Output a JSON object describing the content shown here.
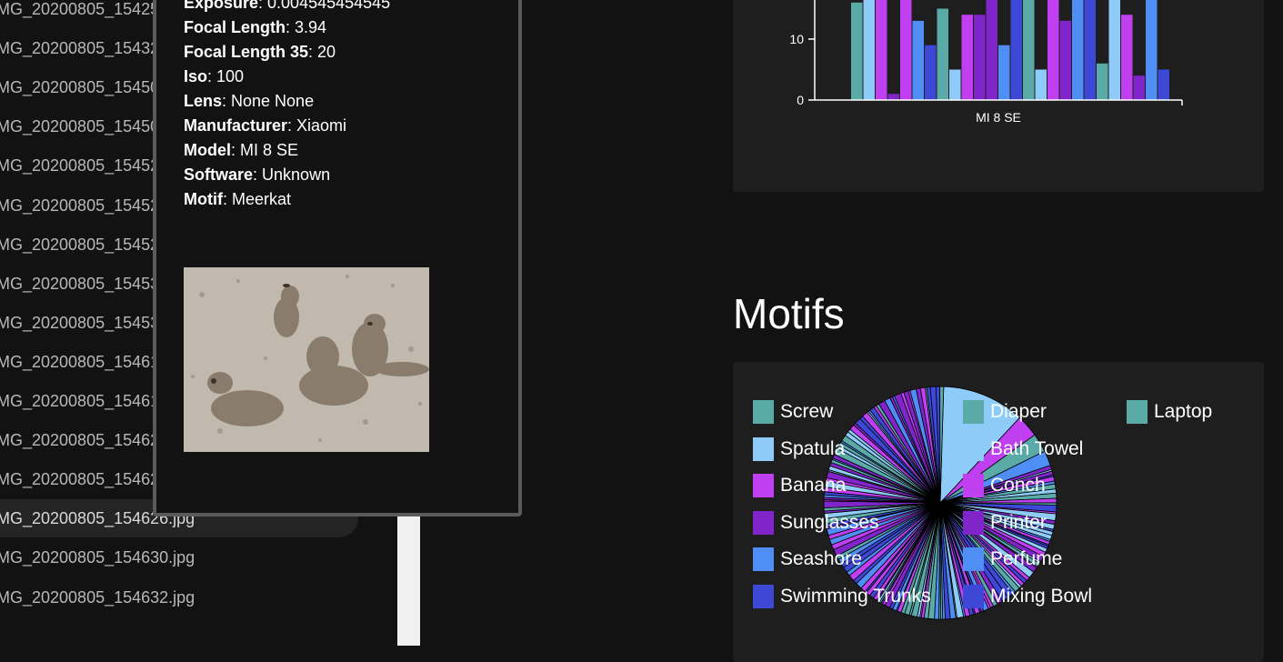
{
  "files": [
    "MG_20200805_15425",
    "MG_20200805_15432",
    "MG_20200805_15450",
    "MG_20200805_15450",
    "MG_20200805_15452",
    "MG_20200805_15452",
    "MG_20200805_15452",
    "MG_20200805_15453",
    "MG_20200805_15453",
    "MG_20200805_15461",
    "MG_20200805_15461",
    "MG_20200805_15462",
    "MG_20200805_15462",
    "MG_20200805_154626.jpg",
    "MG_20200805_154630.jpg",
    "MG_20200805_154632.jpg"
  ],
  "selected_file": "MG_20200805_154626.jpg",
  "popup": {
    "metadata": [
      {
        "key": "Exposure",
        "value": ": 0.004545454545"
      },
      {
        "key": "Focal Length",
        "value": ": 3.94"
      },
      {
        "key": "Focal Length 35",
        "value": ": 20"
      },
      {
        "key": "Iso",
        "value": ": 100"
      },
      {
        "key": "Lens",
        "value": ": None None"
      },
      {
        "key": "Manufacturer",
        "value": ": Xiaomi"
      },
      {
        "key": "Model",
        "value": ": MI 8 SE"
      },
      {
        "key": "Software",
        "value": ": Unknown"
      },
      {
        "key": "Motif",
        "value": ": Meerkat"
      }
    ]
  },
  "motifs_title": "Motifs",
  "colors": {
    "teal": "#5aaaa8",
    "lightblue": "#8ecbf8",
    "magenta": "#c03ff0",
    "purple": "#8025c9",
    "blue": "#4f8ef5",
    "indigo": "#3e48d6"
  },
  "chart_data": [
    {
      "type": "bar",
      "categories": [
        "MI 8 SE"
      ],
      "ylim": [
        0,
        20
      ],
      "yticks": [
        0,
        10
      ],
      "xlabel": "MI 8 SE",
      "values": [
        16,
        20,
        20,
        1,
        20,
        13,
        9,
        15,
        5,
        14,
        14,
        20,
        9,
        20,
        20,
        5,
        20,
        13,
        20,
        20,
        6,
        20,
        14,
        4,
        20,
        5
      ],
      "bar_colors": [
        "teal",
        "lightblue",
        "magenta",
        "purple",
        "magenta",
        "blue",
        "indigo",
        "teal",
        "lightblue",
        "magenta",
        "purple",
        "purple",
        "blue",
        "indigo",
        "teal",
        "lightblue",
        "magenta",
        "purple",
        "blue",
        "indigo",
        "teal",
        "lightblue",
        "magenta",
        "purple",
        "blue",
        "indigo"
      ]
    },
    {
      "type": "pie",
      "legend": [
        {
          "label": "Screw",
          "color": "teal"
        },
        {
          "label": "Diaper",
          "color": "teal"
        },
        {
          "label": "Laptop",
          "color": "teal"
        },
        {
          "label": "Spatula",
          "color": "lightblue"
        },
        {
          "label": "Bath Towel",
          "color": "lightblue"
        },
        {
          "label": "Banana",
          "color": "magenta"
        },
        {
          "label": "Conch",
          "color": "magenta"
        },
        {
          "label": "Sunglasses",
          "color": "purple"
        },
        {
          "label": "Printer",
          "color": "purple"
        },
        {
          "label": "Seashore",
          "color": "blue"
        },
        {
          "label": "Perfume",
          "color": "blue"
        },
        {
          "label": "Swimming Trunks",
          "color": "indigo"
        },
        {
          "label": "Mixing Bowl",
          "color": "indigo"
        }
      ]
    }
  ]
}
